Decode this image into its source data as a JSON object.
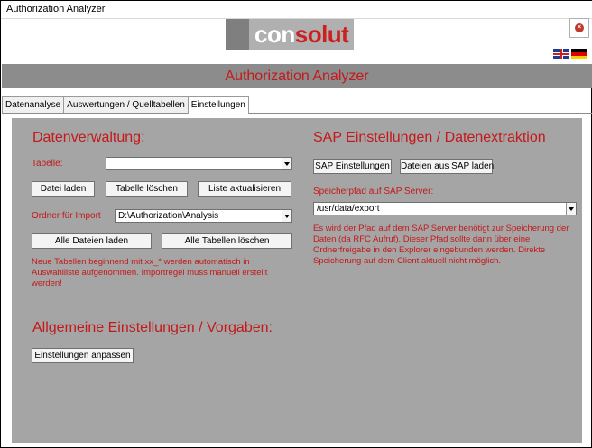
{
  "window": {
    "title": "Authorization Analyzer"
  },
  "header": {
    "logo_left": "con",
    "logo_right": "solut"
  },
  "languages": [
    "english-flag",
    "german-flag"
  ],
  "banner": {
    "title": "Authorization Analyzer"
  },
  "tabs": [
    {
      "label": "Datenanalyse"
    },
    {
      "label": "Auswertungen / Quelltabellen"
    },
    {
      "label": "Einstellungen"
    }
  ],
  "data_management": {
    "heading": "Datenverwaltung:",
    "table_label": "Tabelle:",
    "table_value": "",
    "load_file_button": "Datei laden",
    "delete_table_button": "Tabelle löschen",
    "refresh_list_button": "Liste aktualisieren",
    "import_folder_label": "Ordner für Import",
    "import_folder_value": "D:\\Authorization\\Analysis",
    "load_all_files_button": "Alle Dateien  laden",
    "delete_all_tables_button": "Alle Tabellen löschen",
    "note": "Neue Tabellen beginnend mit  xx_* werden automatisch in Auswahlliste aufgenommen. Importregel muss manuell erstellt werden!"
  },
  "general_settings": {
    "heading": "Allgemeine Einstellungen / Vorgaben:",
    "adjust_settings_button": "Einstellungen anpassen"
  },
  "sap": {
    "heading": "SAP Einstellungen / Datenextraktion",
    "sap_settings_button": "SAP Einstellungen",
    "load_from_sap_button": "Dateien aus SAP laden",
    "storage_path_label": "Speicherpfad auf SAP Server:",
    "storage_path_value": "/usr/data/export",
    "note": "Es wird der Pfad auf dem SAP Server benötigt zur Speicherung der Daten (da RFC Aufruf). Dieser Pfad sollte dann über eine Ordnerfreigabe in den Explorer eingebunden werden. Direkte Speicherung auf  dem Client aktuell nicht möglich."
  },
  "colors": {
    "accent": "#c4181a",
    "panel": "#a5a5a5",
    "banner": "#8c8c8c"
  }
}
